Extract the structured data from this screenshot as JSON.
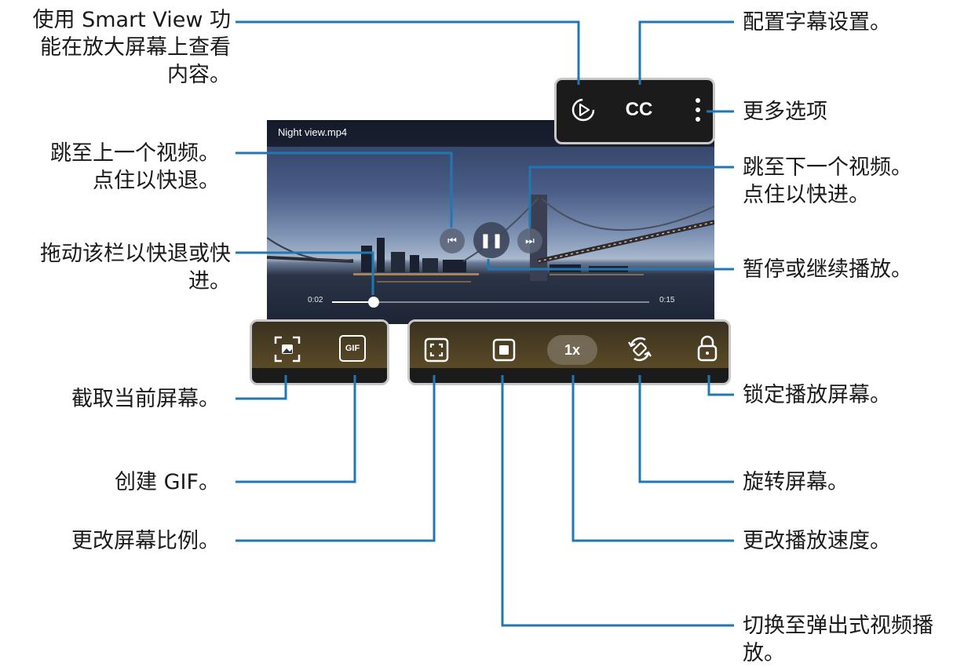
{
  "player": {
    "video_title": "Night view.mp4",
    "current_time": "0:02",
    "end_time": "0:15",
    "progress_fraction": 0.13
  },
  "top_toolbar": {
    "smart_view_icon": "smart-view-icon",
    "cc_label": "CC",
    "more_icon": "more-options-icon"
  },
  "bottom_left_toolbar": {
    "capture_icon": "capture-icon",
    "gif_label": "GIF"
  },
  "bottom_right_toolbar": {
    "ratio_icon": "ratio-icon",
    "popup_icon": "popup-icon",
    "speed_label": "1x",
    "rotate_icon": "rotate-icon",
    "lock_icon": "lock-icon"
  },
  "callouts": {
    "smart_view": "使用 Smart View 功\n能在放大屏幕上查看\n内容。",
    "prev_video": "跳至上一个视频。\n点住以快退。",
    "drag_bar": "拖动该栏以快退或快\n进。",
    "capture": "截取当前屏幕。",
    "create_gif": "创建 GIF。",
    "change_ratio": "更改屏幕比例。",
    "caption_settings": "配置字幕设置。",
    "more_options": "更多选项",
    "next_video": "跳至下一个视频。\n点住以快进。",
    "pause_resume": "暂停或继续播放。",
    "lock_screen": "锁定播放屏幕。",
    "rotate_screen": "旋转屏幕。",
    "change_speed": "更改播放速度。",
    "popup_player": "切换至弹出式视频播\n放。"
  },
  "colors": {
    "callout_line": "#1f78b4",
    "toolbar_bg": "#1b1b1b",
    "toolbar_border": "#c8c8c8"
  }
}
